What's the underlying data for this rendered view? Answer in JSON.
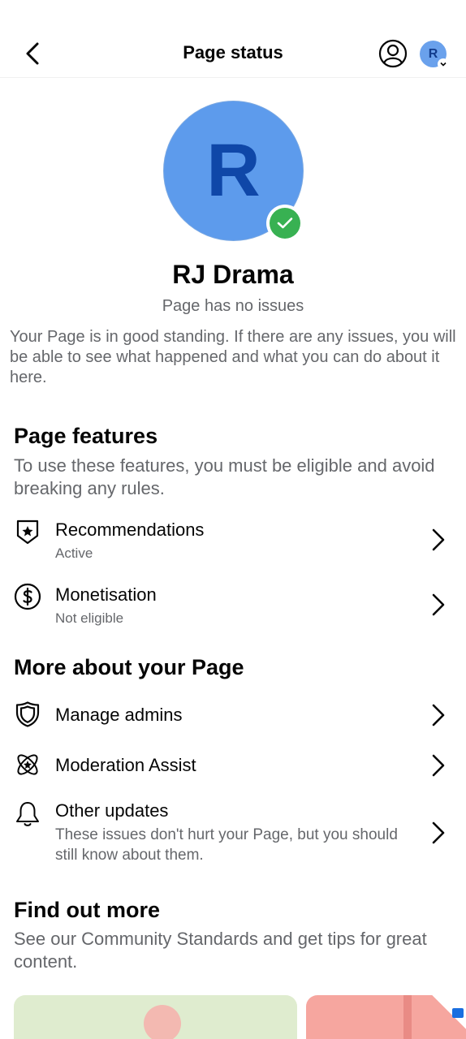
{
  "header": {
    "title": "Page status",
    "avatar_initial": "R"
  },
  "profile": {
    "initial": "R",
    "name": "RJ Drama",
    "issue_status": "Page has no issues",
    "standing_text": "Your Page is in good standing. If there are any issues, you will be able to see what happened and what you can do about it here."
  },
  "page_features": {
    "title": "Page features",
    "subtitle": "To use these features, you must be eligible and avoid breaking any rules.",
    "items": [
      {
        "label": "Recommendations",
        "status": "Active",
        "icon": "shield-star-icon"
      },
      {
        "label": "Monetisation",
        "status": "Not eligible",
        "icon": "dollar-circle-icon"
      }
    ]
  },
  "more_about": {
    "title": "More about your Page",
    "items": [
      {
        "label": "Manage admins",
        "icon": "shield-icon"
      },
      {
        "label": "Moderation Assist",
        "icon": "atom-icon"
      },
      {
        "label": "Other updates",
        "description": "These issues don't hurt your Page, but you should still know about them.",
        "icon": "bell-icon"
      }
    ]
  },
  "find_out_more": {
    "title": "Find out more",
    "subtitle": "See our Community Standards and get tips for great content."
  },
  "colors": {
    "accent_avatar": "#5d9bec",
    "verified_green": "#38b152",
    "secondary_text": "#65676b"
  }
}
